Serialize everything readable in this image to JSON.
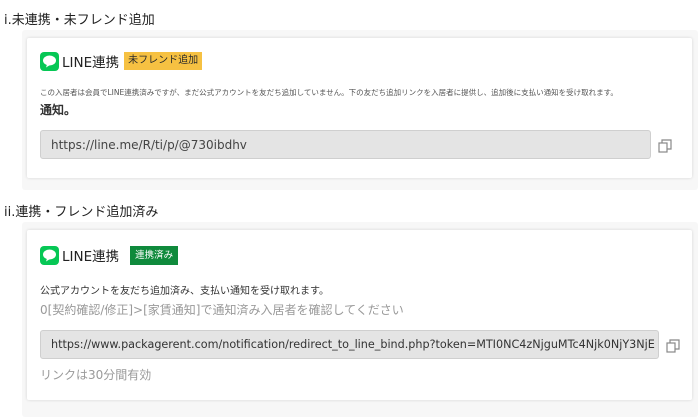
{
  "section1": {
    "title": "i.未連携・未フレンド追加",
    "line_name": "LINE連携",
    "badge": "未フレンド追加",
    "description": "この入居者は会員でLINE連携済みですが、まだ公式アカウントを友だち追加していません。下の友だち追加リンクを入居者に提供し、追加後に支払い通知を受け取れます。",
    "notice": "通知。",
    "url": "https://line.me/R/ti/p/@730ibdhv",
    "copy_icon": "copy-icon"
  },
  "section2": {
    "title": "ii.連携・フレンド追加済み",
    "line_name": "LINE連携",
    "badge": "連携済み",
    "description": "公式アカウントを友だち追加済み、支払い通知を受け取れます。",
    "hint": "0[契約確認/修正]>[家賃通知]で通知済み入居者を確認してください",
    "url": "https://www.packagerent.com/notification/redirect_to_line_bind.php?token=MTI0NC4zNjguMTc4Njk0NjY3NjE",
    "validity": "リンクは30分間有効",
    "copy_icon": "copy-icon"
  },
  "colors": {
    "line_green": "#06c755",
    "badge_yellow": "#f6c142",
    "badge_green": "#0f8a3c"
  }
}
